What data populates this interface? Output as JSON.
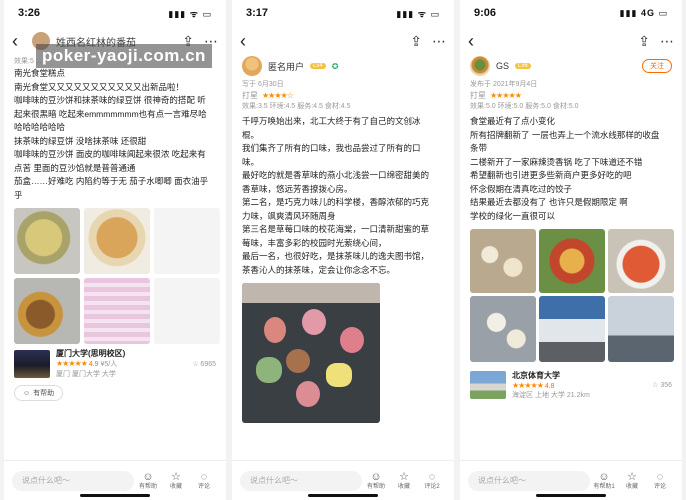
{
  "watermark": "poker-yaoji.com.cn",
  "phones": [
    {
      "time": "3:26",
      "status_icons": "▮▮▮ ᯤ ▭",
      "user_name": "姓西名红林的番茄",
      "meta": "效果:5 ...",
      "text_lines": [
        "南光食堂糕点",
        "南光食堂又又又又又又又又又又又出新品啦！",
        "咖啡味的豆沙饼和抹茶味的绿豆饼 很神奇的搭配 听",
        "起来很黑暗 吃起来emmmmmmm也有点一言难尽哈",
        "哈哈哈哈哈哈",
        "抹茶味的绿豆饼 没啥抹茶味 还很甜",
        "咖啡味的豆沙饼 面皮的咖啡味闻起来很浓 吃起来有",
        "点苦 里面的豆沙馅就是普普通通",
        "茄盒……好难吃 内陷约等于无 茄子水唧唧 面衣油乎",
        "乎"
      ],
      "shop_name": "厦门大学(思明校区)",
      "shop_score": "4.9",
      "shop_price": "¥5/人",
      "shop_sub": "厦门 厦门大学 大学",
      "shop_count": "6965",
      "helpful_label": "有帮助",
      "comment_placeholder": "说点什么吧～",
      "actions": [
        "有帮助",
        "收藏",
        "评论"
      ]
    },
    {
      "time": "3:17",
      "status_icons": "▮▮▮ ᯤ ▭",
      "user_name": "匿名用户",
      "badge": "Lv4",
      "date": "写于 6月30日",
      "rating_label": "打星",
      "meta": "效果:3.5  环境:4.5  服务:4.5  食材:4.5",
      "text_lines": [
        "千呼万唤始出来，北工大终于有了自己的文创冰",
        "棍。",
        "我们集齐了所有的口味，我也品尝过了所有的口",
        "味。",
        "最好吃的就是香草味的燕小北浅尝一口绵密甜美的",
        "香草味，悠远芳香撩拨心房。",
        "第二名，是巧克力味儿的科学楼，香醇浓郁的巧克",
        "力味，飒爽清风环随周身",
        "第三名是草莓口味的校花海棠，一口清新甜蜜的草",
        "莓味，丰富多彩的校园时光萦绕心间，",
        "最后一名，也很好吃，是抹茶味儿的逸夫图书馆，",
        "茶香沁人的抹茶味，定会让你念念不忘。"
      ],
      "comment_placeholder": "说点什么吧～",
      "actions": [
        "有帮助",
        "收藏",
        "评论2"
      ]
    },
    {
      "time": "9:06",
      "status_icons": "▮▮▮ 4G ▭",
      "user_name": "GS",
      "badge": "Lv6",
      "follow_label": "关注",
      "date": "发布于 2021年9月4日",
      "rating_label": "打星",
      "meta": "效果:5.0  环境:5.0  服务:5.0  食材:5.0",
      "text_lines": [
        "食堂最近有了点小变化",
        "所有招牌翻新了 一层也弄上一个流水线那样的收盘",
        "条带",
        "二楼新开了一家麻辣烫香锅  吃了下味道还不错",
        "希望翻新也引进更多些新商户更多好吃的吧",
        "怀念假期在清真吃过的饺子",
        "结果最近去都没有了 也许只是假期限定 啊",
        "学校的绿化一直很可以"
      ],
      "shop_name": "北京体育大学",
      "shop_score": "4.8",
      "shop_sub": "海淀区 上地 大学  21.2km",
      "shop_count": "356",
      "comment_placeholder": "说点什么吧～",
      "actions": [
        "有帮助1",
        "收藏",
        "评论"
      ]
    }
  ]
}
